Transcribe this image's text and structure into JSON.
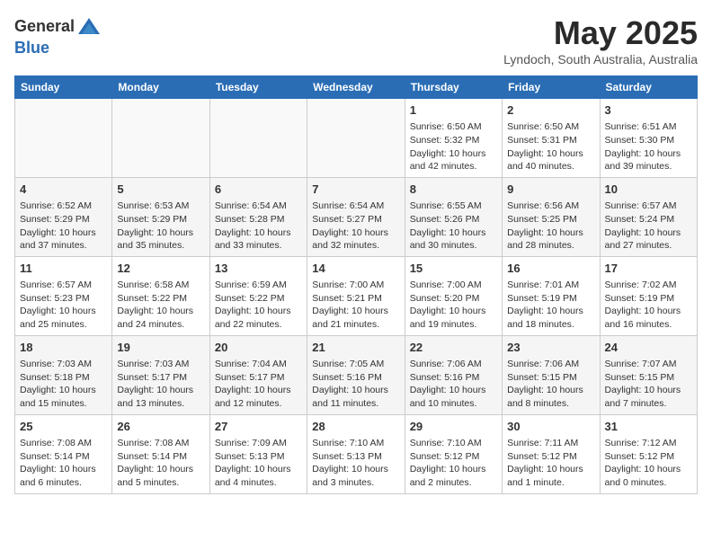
{
  "logo": {
    "general": "General",
    "blue": "Blue"
  },
  "header": {
    "month": "May 2025",
    "location": "Lyndoch, South Australia, Australia"
  },
  "days_of_week": [
    "Sunday",
    "Monday",
    "Tuesday",
    "Wednesday",
    "Thursday",
    "Friday",
    "Saturday"
  ],
  "weeks": [
    [
      {
        "day": "",
        "info": ""
      },
      {
        "day": "",
        "info": ""
      },
      {
        "day": "",
        "info": ""
      },
      {
        "day": "",
        "info": ""
      },
      {
        "day": "1",
        "info": "Sunrise: 6:50 AM\nSunset: 5:32 PM\nDaylight: 10 hours\nand 42 minutes."
      },
      {
        "day": "2",
        "info": "Sunrise: 6:50 AM\nSunset: 5:31 PM\nDaylight: 10 hours\nand 40 minutes."
      },
      {
        "day": "3",
        "info": "Sunrise: 6:51 AM\nSunset: 5:30 PM\nDaylight: 10 hours\nand 39 minutes."
      }
    ],
    [
      {
        "day": "4",
        "info": "Sunrise: 6:52 AM\nSunset: 5:29 PM\nDaylight: 10 hours\nand 37 minutes."
      },
      {
        "day": "5",
        "info": "Sunrise: 6:53 AM\nSunset: 5:29 PM\nDaylight: 10 hours\nand 35 minutes."
      },
      {
        "day": "6",
        "info": "Sunrise: 6:54 AM\nSunset: 5:28 PM\nDaylight: 10 hours\nand 33 minutes."
      },
      {
        "day": "7",
        "info": "Sunrise: 6:54 AM\nSunset: 5:27 PM\nDaylight: 10 hours\nand 32 minutes."
      },
      {
        "day": "8",
        "info": "Sunrise: 6:55 AM\nSunset: 5:26 PM\nDaylight: 10 hours\nand 30 minutes."
      },
      {
        "day": "9",
        "info": "Sunrise: 6:56 AM\nSunset: 5:25 PM\nDaylight: 10 hours\nand 28 minutes."
      },
      {
        "day": "10",
        "info": "Sunrise: 6:57 AM\nSunset: 5:24 PM\nDaylight: 10 hours\nand 27 minutes."
      }
    ],
    [
      {
        "day": "11",
        "info": "Sunrise: 6:57 AM\nSunset: 5:23 PM\nDaylight: 10 hours\nand 25 minutes."
      },
      {
        "day": "12",
        "info": "Sunrise: 6:58 AM\nSunset: 5:22 PM\nDaylight: 10 hours\nand 24 minutes."
      },
      {
        "day": "13",
        "info": "Sunrise: 6:59 AM\nSunset: 5:22 PM\nDaylight: 10 hours\nand 22 minutes."
      },
      {
        "day": "14",
        "info": "Sunrise: 7:00 AM\nSunset: 5:21 PM\nDaylight: 10 hours\nand 21 minutes."
      },
      {
        "day": "15",
        "info": "Sunrise: 7:00 AM\nSunset: 5:20 PM\nDaylight: 10 hours\nand 19 minutes."
      },
      {
        "day": "16",
        "info": "Sunrise: 7:01 AM\nSunset: 5:19 PM\nDaylight: 10 hours\nand 18 minutes."
      },
      {
        "day": "17",
        "info": "Sunrise: 7:02 AM\nSunset: 5:19 PM\nDaylight: 10 hours\nand 16 minutes."
      }
    ],
    [
      {
        "day": "18",
        "info": "Sunrise: 7:03 AM\nSunset: 5:18 PM\nDaylight: 10 hours\nand 15 minutes."
      },
      {
        "day": "19",
        "info": "Sunrise: 7:03 AM\nSunset: 5:17 PM\nDaylight: 10 hours\nand 13 minutes."
      },
      {
        "day": "20",
        "info": "Sunrise: 7:04 AM\nSunset: 5:17 PM\nDaylight: 10 hours\nand 12 minutes."
      },
      {
        "day": "21",
        "info": "Sunrise: 7:05 AM\nSunset: 5:16 PM\nDaylight: 10 hours\nand 11 minutes."
      },
      {
        "day": "22",
        "info": "Sunrise: 7:06 AM\nSunset: 5:16 PM\nDaylight: 10 hours\nand 10 minutes."
      },
      {
        "day": "23",
        "info": "Sunrise: 7:06 AM\nSunset: 5:15 PM\nDaylight: 10 hours\nand 8 minutes."
      },
      {
        "day": "24",
        "info": "Sunrise: 7:07 AM\nSunset: 5:15 PM\nDaylight: 10 hours\nand 7 minutes."
      }
    ],
    [
      {
        "day": "25",
        "info": "Sunrise: 7:08 AM\nSunset: 5:14 PM\nDaylight: 10 hours\nand 6 minutes."
      },
      {
        "day": "26",
        "info": "Sunrise: 7:08 AM\nSunset: 5:14 PM\nDaylight: 10 hours\nand 5 minutes."
      },
      {
        "day": "27",
        "info": "Sunrise: 7:09 AM\nSunset: 5:13 PM\nDaylight: 10 hours\nand 4 minutes."
      },
      {
        "day": "28",
        "info": "Sunrise: 7:10 AM\nSunset: 5:13 PM\nDaylight: 10 hours\nand 3 minutes."
      },
      {
        "day": "29",
        "info": "Sunrise: 7:10 AM\nSunset: 5:12 PM\nDaylight: 10 hours\nand 2 minutes."
      },
      {
        "day": "30",
        "info": "Sunrise: 7:11 AM\nSunset: 5:12 PM\nDaylight: 10 hours\nand 1 minute."
      },
      {
        "day": "31",
        "info": "Sunrise: 7:12 AM\nSunset: 5:12 PM\nDaylight: 10 hours\nand 0 minutes."
      }
    ]
  ]
}
